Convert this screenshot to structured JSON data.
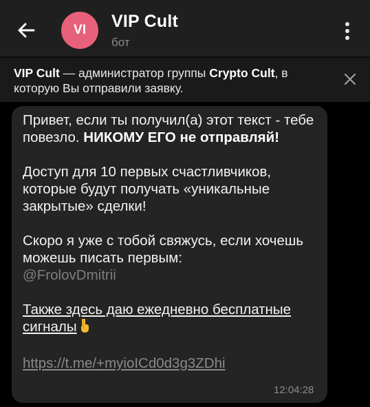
{
  "colors": {
    "avatar_bg": "#e8617a",
    "topbar_bg": "#1f1f1f",
    "bubble_bg": "#242424",
    "link": "#8a8a8a"
  },
  "header": {
    "back_icon": "arrow-left-icon",
    "avatar_initials": "VI",
    "title": "VIP Cult",
    "subtitle": "бот",
    "menu_icon": "more-vertical-icon"
  },
  "notice": {
    "bot_name": "VIP Cult",
    "text_before_group": " — администратор группы ",
    "group_name": "Crypto Cult",
    "text_after_group": ", в которую Вы отправили заявку.",
    "close_icon": "close-icon"
  },
  "message": {
    "para1_plain": "Привет, если ты получил(а) этот текст - тебе повезло. ",
    "para1_bold": "НИКОМУ ЕГО не отправляй!",
    "para2": "Доступ для 10 первых счастливчиков, которые будут получать «уникальные закрытые» сделки!",
    "para3_plain": "Скоро я уже с тобой свяжусь, если хочешь можешь писать первым:",
    "mention": "@FrolovDmitrii",
    "para4": "Также здесь даю ежедневно бесплатные сигналы",
    "para4_emoji": "pointing-down-hand-icon",
    "link": "https://t.me/+myioICd0d3g3ZDhi",
    "time": "12:04:28"
  }
}
